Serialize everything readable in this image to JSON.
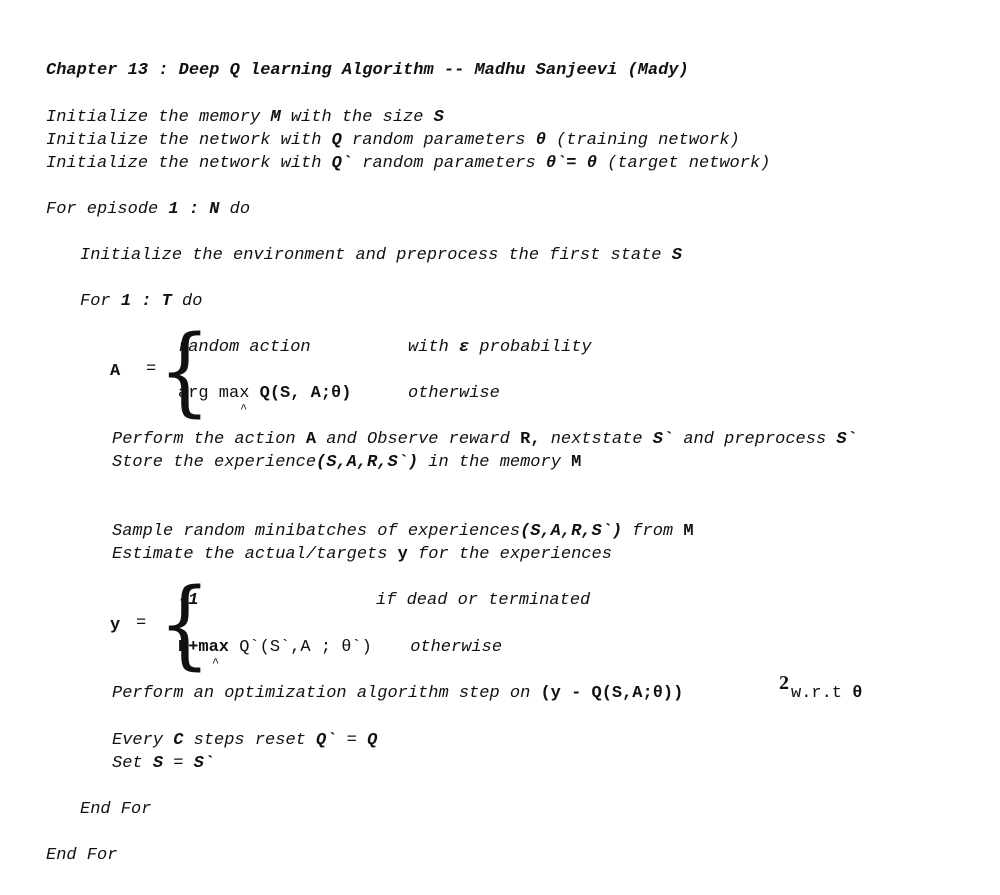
{
  "title": {
    "t1": "Chapter 13 : Deep Q learning Algorithm -- Madhu Sanjeevi (Mady)"
  },
  "init": {
    "l1a": "Initialize the memory ",
    "l1M": "M",
    "l1b": " with the size ",
    "l1S": "S",
    "l2a": "Initialize the network with ",
    "l2Q": "Q",
    "l2b": " random parameters ",
    "l2th": "θ",
    "l2c": " (training network)",
    "l3a": "Initialize the network with ",
    "l3Q": "Q`",
    "l3b": " random parameters ",
    "l3th": "θ`= θ",
    "l3c": " (target network)"
  },
  "episode": {
    "a": "For episode ",
    "n": "1 : N",
    "do": " do"
  },
  "env": {
    "a": "Initialize the environment and preprocess the first state ",
    "S": "S"
  },
  "loop": {
    "a": "For ",
    "n": "1 : T",
    "do": " do"
  },
  "action_eq": {
    "lhs": "A",
    "eq": "=",
    "brace": "{",
    "c1": "random action",
    "c1b": "with ",
    "eps": "ε",
    "c1c": " probability",
    "c2a": "arg max ",
    "c2b": "Q(S, A;θ)",
    "c2c": "otherwise",
    "hat": "^"
  },
  "perform": {
    "a": "Perform the action ",
    "A": "A",
    "b": " and Observe reward ",
    "R": "R,",
    "c": " nextstate ",
    "S1": "S`",
    "d": " and preprocess ",
    "S2": "S`"
  },
  "store": {
    "a": "Store the experience",
    "t": "(S,A,R,S`)",
    "b": " in the memory ",
    "M": "M"
  },
  "sample": {
    "a": "Sample random minibatches of experiences",
    "t": "(S,A,R,S`)",
    "b": " from ",
    "M": "M"
  },
  "estimate": {
    "a": "Estimate the actual/targets ",
    "y": "y",
    "b": " for the experiences"
  },
  "target_eq": {
    "lhs": "y",
    "eq": "=",
    "brace": "{",
    "c1": "-1",
    "c1b": "if dead or terminated",
    "c2a": "R+max",
    "c2b": " Q`(S`,A ; θ`)",
    "c2c": " otherwise",
    "hat": "^"
  },
  "optim": {
    "a": "Perform an optimization algorithm step on ",
    "loss": "(y - Q(S,A;θ))",
    "sq": "2",
    "b": "w.r.t ",
    "th": "θ"
  },
  "every": {
    "a": "Every ",
    "C": "C",
    "b": " steps reset ",
    "Q1": "Q`",
    "c": " = ",
    "Q2": "Q"
  },
  "set": {
    "a": "Set ",
    "S": "S",
    "b": " = ",
    "S2": "S`"
  },
  "end_inner": "End For",
  "end_outer": "End For"
}
